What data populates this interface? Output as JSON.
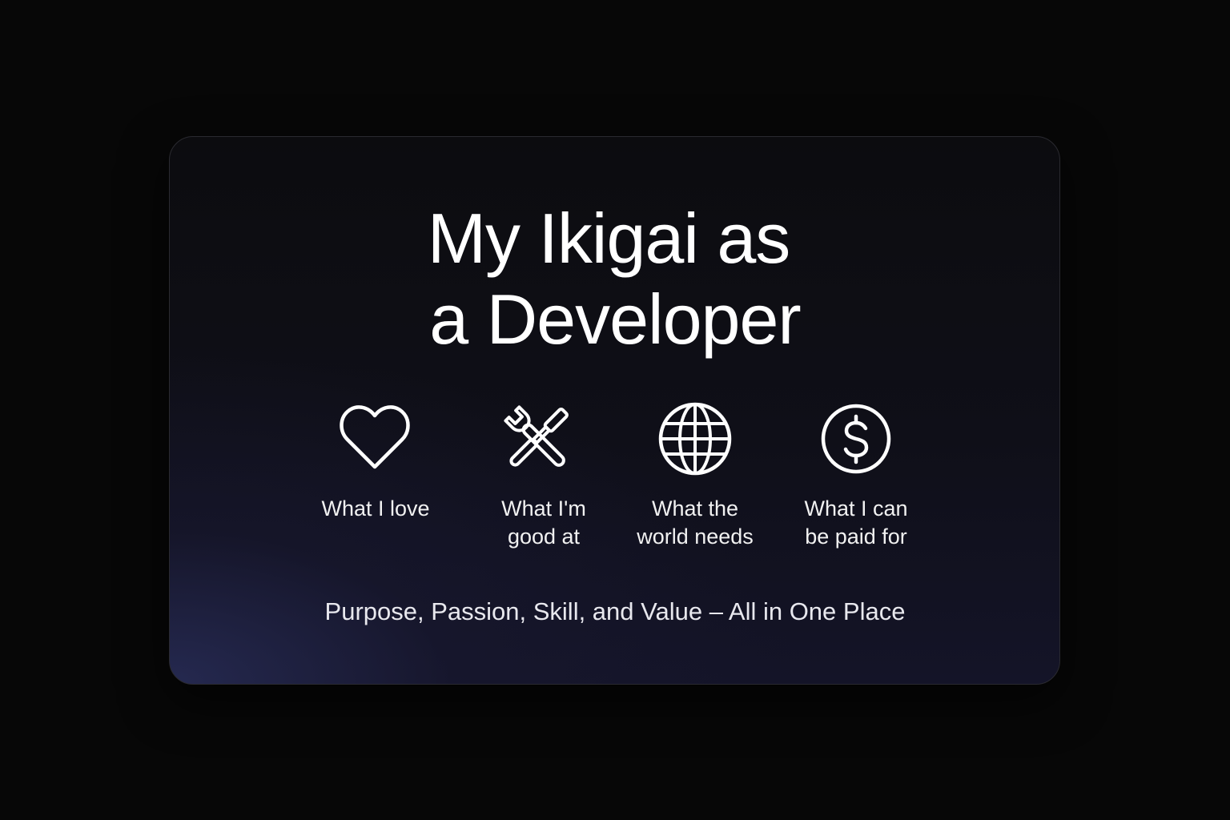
{
  "card": {
    "title_line_1": "My Ikigai as",
    "title_line_2": "a Developer",
    "items": [
      {
        "label": "What I love",
        "icon": "heart-icon"
      },
      {
        "label": "What I'm\ngood at",
        "icon": "tools-icon"
      },
      {
        "label": "What the\nworld needs",
        "icon": "globe-icon"
      },
      {
        "label": "What I can\nbe paid for",
        "icon": "dollar-icon"
      }
    ],
    "tagline": "Purpose, Passion, Skill, and Value – All in One Place"
  },
  "colors": {
    "background": "#070707",
    "card_top": "#0c0c0f",
    "card_glow": "#262a52",
    "text": "#ffffff"
  }
}
